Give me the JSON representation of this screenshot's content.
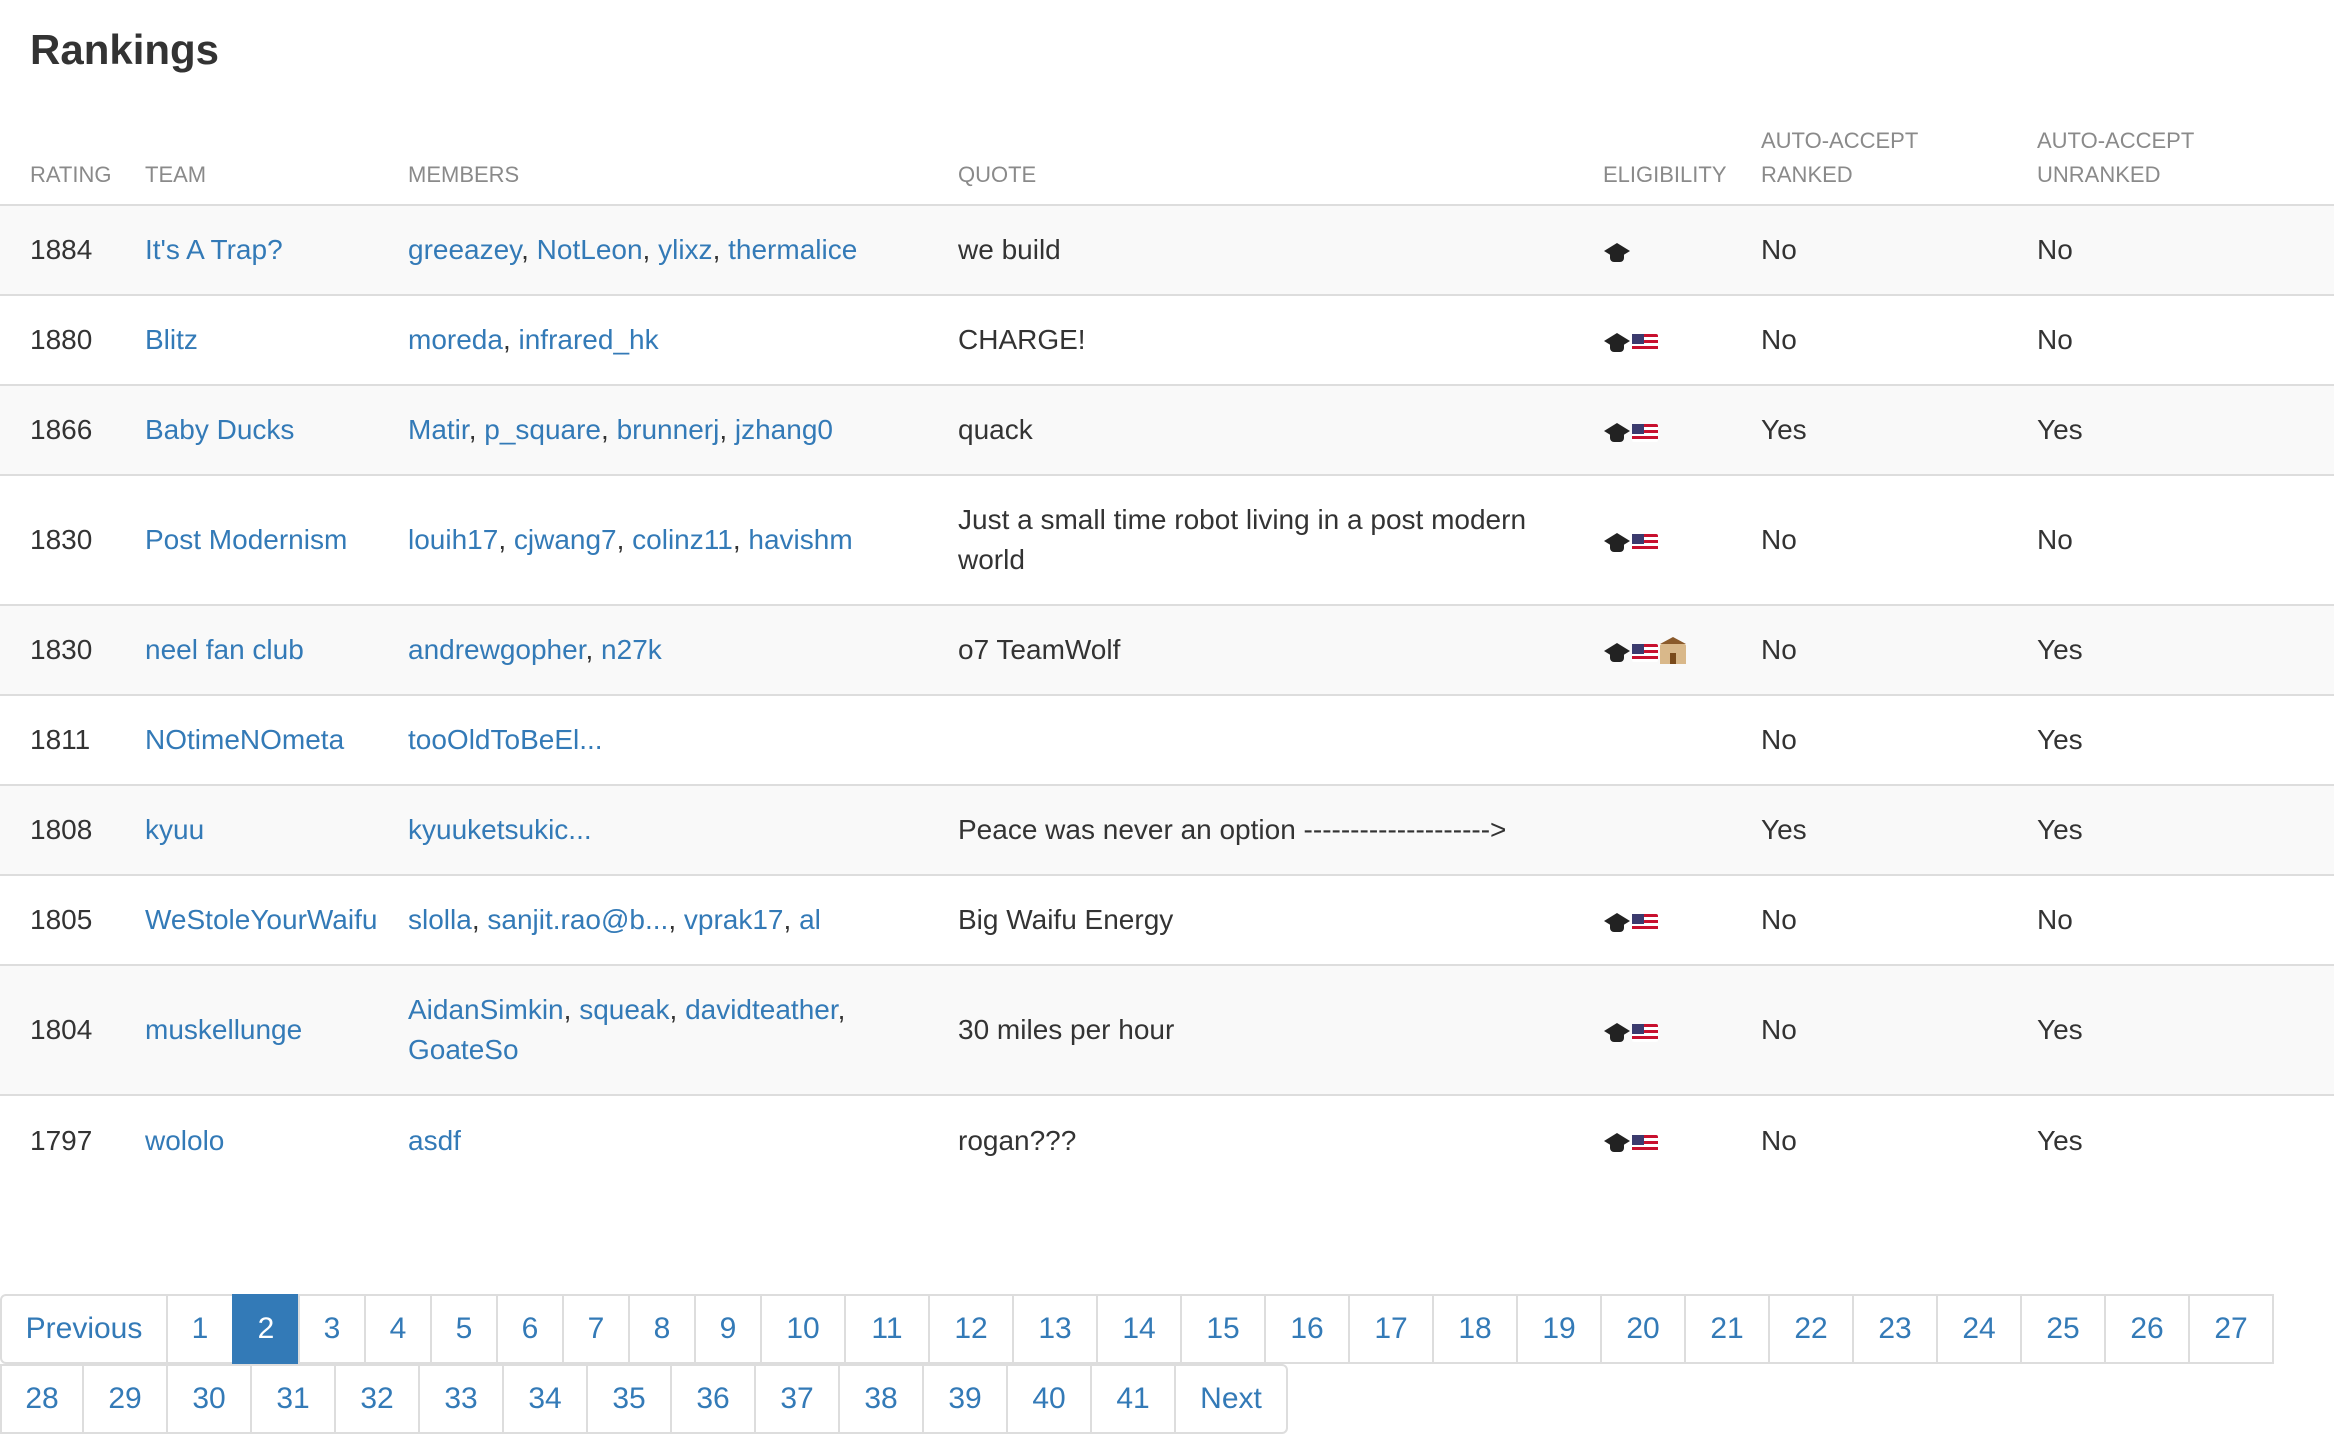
{
  "title": "Rankings",
  "columns": {
    "rating": "RATING",
    "team": "TEAM",
    "members": "MEMBERS",
    "quote": "QUOTE",
    "eligibility": "ELIGIBILITY",
    "auto_ranked": "AUTO-ACCEPT RANKED",
    "auto_unranked": "AUTO-ACCEPT UNRANKED"
  },
  "rows": [
    {
      "rating": "1884",
      "team": "It's A Trap?",
      "members": [
        "greeazey",
        "NotLeon",
        "ylixz",
        "thermalice"
      ],
      "quote": "we build",
      "eligibility": [
        "student-icon"
      ],
      "ranked": "No",
      "unranked": "No"
    },
    {
      "rating": "1880",
      "team": "Blitz",
      "members": [
        "moreda",
        "infrared_hk"
      ],
      "quote": "CHARGE!",
      "eligibility": [
        "student-icon",
        "us-flag-icon"
      ],
      "ranked": "No",
      "unranked": "No"
    },
    {
      "rating": "1866",
      "team": "Baby Ducks",
      "members": [
        "Matir",
        "p_square",
        "brunnerj",
        "jzhang0"
      ],
      "quote": "quack",
      "eligibility": [
        "student-icon",
        "us-flag-icon"
      ],
      "ranked": "Yes",
      "unranked": "Yes"
    },
    {
      "rating": "1830",
      "team": "Post Modernism",
      "members": [
        "louih17",
        "cjwang7",
        "colinz11",
        "havishm"
      ],
      "quote": "Just a small time robot living in a post modern world",
      "eligibility": [
        "student-icon",
        "us-flag-icon"
      ],
      "ranked": "No",
      "unranked": "No",
      "tall": true
    },
    {
      "rating": "1830",
      "team": "neel fan club",
      "members": [
        "andrewgopher",
        "n27k"
      ],
      "quote": "o7 TeamWolf",
      "eligibility": [
        "student-icon",
        "us-flag-icon",
        "school-icon"
      ],
      "ranked": "No",
      "unranked": "Yes"
    },
    {
      "rating": "1811",
      "team": "NOtimeNOmeta",
      "members": [
        "tooOldToBeEl..."
      ],
      "quote": "",
      "eligibility": [],
      "ranked": "No",
      "unranked": "Yes"
    },
    {
      "rating": "1808",
      "team": "kyuu",
      "members": [
        "kyuuketsukic..."
      ],
      "quote": "Peace was never an option -------------------->",
      "eligibility": [],
      "ranked": "Yes",
      "unranked": "Yes"
    },
    {
      "rating": "1805",
      "team": "WeStoleYourWaifu",
      "members": [
        "slolla",
        "sanjit.rao@b...",
        "vprak17",
        "al"
      ],
      "quote": "Big Waifu Energy",
      "eligibility": [
        "student-icon",
        "us-flag-icon"
      ],
      "ranked": "No",
      "unranked": "No"
    },
    {
      "rating": "1804",
      "team": "muskellunge",
      "members": [
        "AidanSimkin",
        "squeak",
        "davidteather",
        "GoateSo"
      ],
      "quote": "30 miles per hour",
      "eligibility": [
        "student-icon",
        "us-flag-icon"
      ],
      "ranked": "No",
      "unranked": "Yes",
      "tall": true
    },
    {
      "rating": "1797",
      "team": "wololo",
      "members": [
        "asdf"
      ],
      "quote": "rogan???",
      "eligibility": [
        "student-icon",
        "us-flag-icon"
      ],
      "ranked": "No",
      "unranked": "Yes"
    }
  ],
  "pagination": {
    "previous_label": "Previous",
    "next_label": "Next",
    "active": "2",
    "row1": [
      "1",
      "2",
      "3",
      "4",
      "5",
      "6",
      "7",
      "8",
      "9",
      "10",
      "11",
      "12",
      "13",
      "14",
      "15",
      "16",
      "17",
      "18",
      "19",
      "20",
      "21",
      "22",
      "23",
      "24",
      "25",
      "26",
      "27"
    ],
    "row2": [
      "28",
      "29",
      "30",
      "31",
      "32",
      "33",
      "34",
      "35",
      "36",
      "37",
      "38",
      "39",
      "40",
      "41"
    ]
  },
  "colors": {
    "link": "#337ab7",
    "active_page": "#337ab7",
    "stripe": "#f9f9f9",
    "border": "#dddddd"
  }
}
